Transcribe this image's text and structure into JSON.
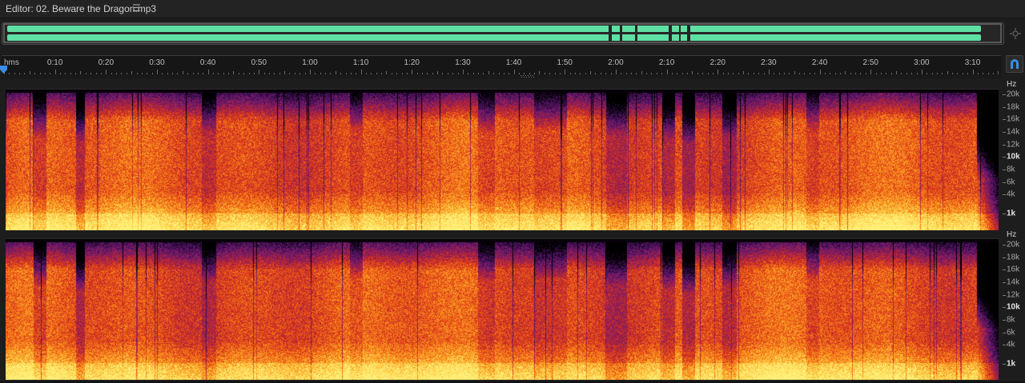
{
  "editor": {
    "title": "Editor: 02. Beware the Dragon.mp3",
    "menu_icon": "hamburger-menu-icon"
  },
  "overview": {
    "waveform_color": "#5fe0a3",
    "icon": "zoom-navigator-icon"
  },
  "timeline": {
    "unit_label": "hms",
    "labels": [
      "0:10",
      "0:20",
      "0:30",
      "0:40",
      "0:50",
      "1:00",
      "1:10",
      "1:20",
      "1:30",
      "1:40",
      "1:50",
      "2:00",
      "2:10",
      "2:20",
      "2:30",
      "2:40",
      "2:50",
      "3:00",
      "3:10"
    ],
    "duration_seconds": 196,
    "playhead_seconds": 0,
    "snap_icon": "magnet-icon",
    "playhead_color": "#3a8ee6"
  },
  "channels": [
    {
      "id": "left"
    },
    {
      "id": "right"
    }
  ],
  "frequency_scale": {
    "unit": "Hz",
    "labels": [
      {
        "text": "20k",
        "hz": 20000,
        "major": false
      },
      {
        "text": "18k",
        "hz": 18000,
        "major": false
      },
      {
        "text": "16k",
        "hz": 16000,
        "major": false
      },
      {
        "text": "14k",
        "hz": 14000,
        "major": false
      },
      {
        "text": "12k",
        "hz": 12000,
        "major": false
      },
      {
        "text": "10k",
        "hz": 10000,
        "major": true
      },
      {
        "text": "8k",
        "hz": 8000,
        "major": false
      },
      {
        "text": "6k",
        "hz": 6000,
        "major": false
      },
      {
        "text": "4k",
        "hz": 4000,
        "major": false
      },
      {
        "text": "1k",
        "hz": 1000,
        "major": true
      }
    ]
  },
  "spectral_palette": [
    "#000000",
    "#2a0a3a",
    "#5a1570",
    "#8a1f60",
    "#c0242a",
    "#e84a16",
    "#f88a1a",
    "#fcc43a",
    "#fff07a"
  ]
}
